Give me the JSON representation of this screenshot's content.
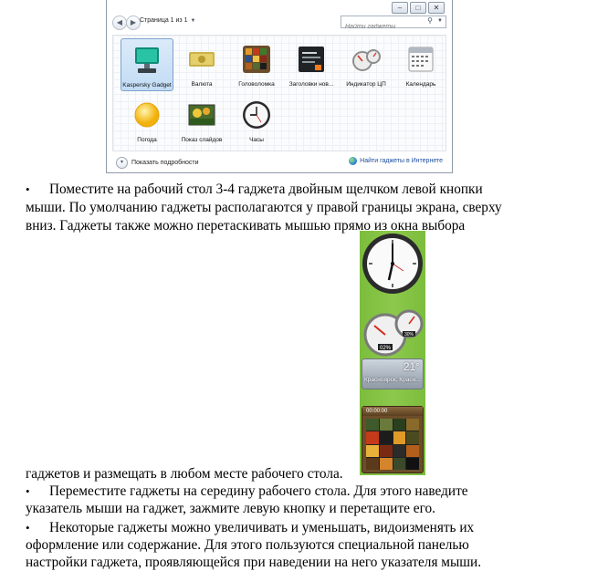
{
  "gadget_window": {
    "pager_label": "Страница 1 из 1",
    "search_placeholder": "Найти гаджеты",
    "gadgets": [
      {
        "label": "Kaspersky Gadget",
        "icon": "kaspersky-icon",
        "selected": true
      },
      {
        "label": "Валюта",
        "icon": "currency-icon"
      },
      {
        "label": "Головоломка",
        "icon": "puzzle-icon"
      },
      {
        "label": "Заголовки нов...",
        "icon": "news-icon"
      },
      {
        "label": "Индикатор ЦП",
        "icon": "cpu-meter-icon"
      },
      {
        "label": "Календарь",
        "icon": "calendar-icon"
      },
      {
        "label": "Погода",
        "icon": "weather-icon"
      },
      {
        "label": "Показ слайдов",
        "icon": "slideshow-icon"
      },
      {
        "label": "Часы",
        "icon": "clock-icon"
      }
    ],
    "show_details": "Показать подробности",
    "find_online": "Найти гаджеты в Интернете"
  },
  "text": {
    "p1_l1": "Поместите на рабочий стол 3-4 гаджета двойным щелчком левой кнопки",
    "p1_l2": "мыши. По умолчанию гаджеты располагаются у правой границы экрана, сверху",
    "p1_l3": "вниз. Гаджеты также можно перетаскивать мышью прямо из окна выбора",
    "p1_l4": "гаджетов и размещать в любом месте рабочего стола.",
    "p2_l1": "Переместите гаджеты на середину рабочего стола. Для этого наведите",
    "p2_l2": "указатель мыши на гаджет, зажмите левую кнопку и перетащите его.",
    "p3_l1": "Некоторые гаджеты можно увеличивать и уменьшать, видоизменять их",
    "p3_l2": "оформление или содержание. Для этого пользуются специальной панелью",
    "p3_l3": "настройки гаджета, проявляющейся при наведении на него указателя мыши.",
    "bullet": "•"
  },
  "sidebar": {
    "weather_temp": "21°",
    "weather_city": "Красноярск, Красн...",
    "cpu_value": "02%",
    "mem_value": "30%",
    "puzzle_time": "00:00:00"
  }
}
